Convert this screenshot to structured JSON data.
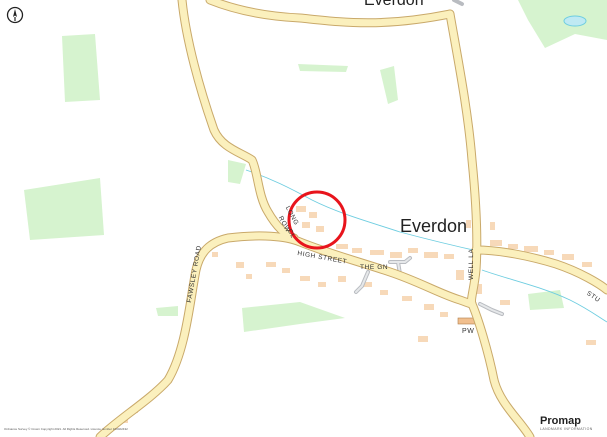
{
  "map": {
    "places": [
      {
        "name": "Everdon",
        "key": "top"
      },
      {
        "name": "Everdon",
        "key": "main"
      }
    ],
    "roads": {
      "high_street": "HIGH STREET",
      "the_green": "THE GN",
      "fawsley_road": "FAWSLEY ROAD",
      "well_lane": "WELL LA",
      "stu": "STU",
      "long_row_1": "LONG",
      "long_row_2": "ROW",
      "long_row_3": "CL"
    },
    "features": {
      "place_of_worship": "PW"
    },
    "highlight": {
      "color": "#e8141c"
    },
    "colors": {
      "road_fill": "#fbf0bd",
      "road_edge": "#c9a96a",
      "woodland": "#d6f3cf",
      "water": "#6ecde0",
      "building": "#f7d9b9",
      "minor_road": "#cfd2d6"
    },
    "icons": {
      "compass": "north-arrow-icon"
    },
    "copyright": "Ordnance Survey © Crown Copyright 2021. All Rights Reserved. Licence number 100022432",
    "brand": {
      "name": "Promap",
      "tagline": "LANDMARK INFORMATION"
    }
  }
}
